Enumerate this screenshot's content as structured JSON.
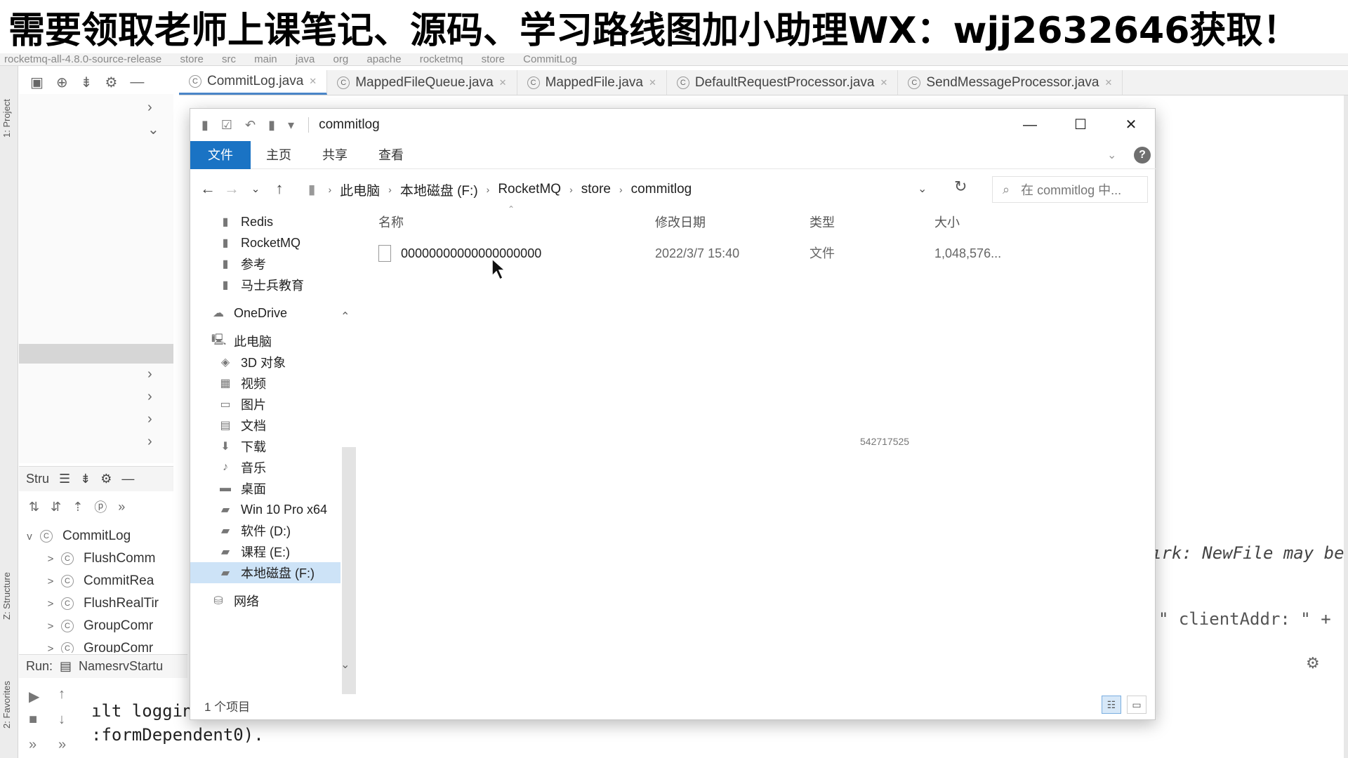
{
  "banner": {
    "text": "需要领取老师上课笔记、源码、学习路线图加小助理WX：wjj2632646获取！"
  },
  "ide": {
    "crumbs": [
      "rocketmq-all-4.8.0-source-release",
      "store",
      "src",
      "main",
      "java",
      "org",
      "apache",
      "rocketmq",
      "store",
      "CommitLog"
    ],
    "left_tabs": {
      "project": "1: Project",
      "structure": "Z: Structure",
      "favorites": "2: Favorites"
    },
    "tabs": [
      {
        "label": "CommitLog.java",
        "active": true
      },
      {
        "label": "MappedFileQueue.java"
      },
      {
        "label": "MappedFile.java"
      },
      {
        "label": "DefaultRequestProcessor.java"
      },
      {
        "label": "SendMessageProcessor.java"
      }
    ],
    "structure": {
      "title": "Stru",
      "items": [
        {
          "label": "CommitLog",
          "chev": "v"
        },
        {
          "label": "FlushComm",
          "chev": ">"
        },
        {
          "label": "CommitRea",
          "chev": ">"
        },
        {
          "label": "FlushRealTir",
          "chev": ">"
        },
        {
          "label": "GroupComr",
          "chev": ">"
        },
        {
          "label": "GroupComr",
          "chev": ">"
        }
      ]
    },
    "run": {
      "label": "Run:",
      "config": "NamesrvStartu"
    },
    "console": {
      "line1": "ılt loggin",
      "line2": ":formDependent0)."
    },
    "code_right": {
      "line1": "ırk: NewFile may be",
      "line2": "\" clientAddr: \" +"
    }
  },
  "explorer": {
    "title": "commitlog",
    "ribbon": {
      "file": "文件",
      "home": "主页",
      "share": "共享",
      "view": "查看"
    },
    "help": "?",
    "address": [
      "此电脑",
      "本地磁盘 (F:)",
      "RocketMQ",
      "store",
      "commitlog"
    ],
    "search_placeholder": "在 commitlog 中...",
    "nav": [
      {
        "label": "Redis",
        "icon": "pin"
      },
      {
        "label": "RocketMQ",
        "icon": "pin"
      },
      {
        "label": "参考",
        "icon": "pin"
      },
      {
        "label": "马士兵教育",
        "icon": "pin"
      },
      {
        "label": "OneDrive",
        "icon": "cloud"
      },
      {
        "label": "此电脑",
        "icon": "pc"
      },
      {
        "label": "3D 对象",
        "icon": "cube"
      },
      {
        "label": "视频",
        "icon": "film"
      },
      {
        "label": "图片",
        "icon": "image"
      },
      {
        "label": "文档",
        "icon": "doc"
      },
      {
        "label": "下载",
        "icon": "download"
      },
      {
        "label": "音乐",
        "icon": "music"
      },
      {
        "label": "桌面",
        "icon": "desktop"
      },
      {
        "label": "Win 10 Pro x64",
        "icon": "drive"
      },
      {
        "label": "软件 (D:)",
        "icon": "drive"
      },
      {
        "label": "课程 (E:)",
        "icon": "drive"
      },
      {
        "label": "本地磁盘 (F:)",
        "icon": "drive",
        "selected": true
      },
      {
        "label": "网络",
        "icon": "network"
      }
    ],
    "columns": {
      "name": "名称",
      "modified": "修改日期",
      "type": "类型",
      "size": "大小"
    },
    "files": [
      {
        "name": "00000000000000000000",
        "modified": "2022/3/7 15:40",
        "type": "文件",
        "size": "1,048,576..."
      }
    ],
    "watermark": "542717525",
    "status": "1 个项目"
  }
}
